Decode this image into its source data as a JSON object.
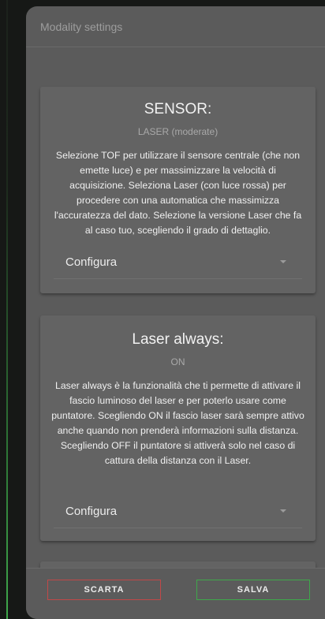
{
  "header": {
    "title": "Modality settings"
  },
  "cards": [
    {
      "title": "SENSOR:",
      "value": "LASER (moderate)",
      "description": "Selezione TOF per utilizzare il sensore centrale (che non emette luce) e per massimizzare la velocità di acquisizione. Seleziona Laser (con luce rossa) per procedere con una automatica che massimizza l'accuratezza del dato. Selezione la versione Laser che fa al caso tuo, scegliendo il grado di dettaglio.",
      "configure_label": "Configura"
    },
    {
      "title": "Laser always:",
      "value": "ON",
      "description": "Laser always è la funzionalità che ti permette di attivare il fascio luminoso del laser e per poterlo usare come puntatore. Scegliendo ON il fascio laser sarà sempre attivo anche quando non prenderà informazioni sulla distanza. Scegliendo OFF il puntatore si attiverà solo nel caso di cattura della distanza con il Laser.",
      "configure_label": "Configura"
    }
  ],
  "footer": {
    "discard_label": "SCARTA",
    "save_label": "SALVA"
  },
  "colors": {
    "discard_border": "#c14848",
    "save_border": "#3fa84b",
    "dialog_bg": "#5b5b5b",
    "card_bg": "#636363"
  },
  "icons": [
    "chevron-down-icon"
  ]
}
